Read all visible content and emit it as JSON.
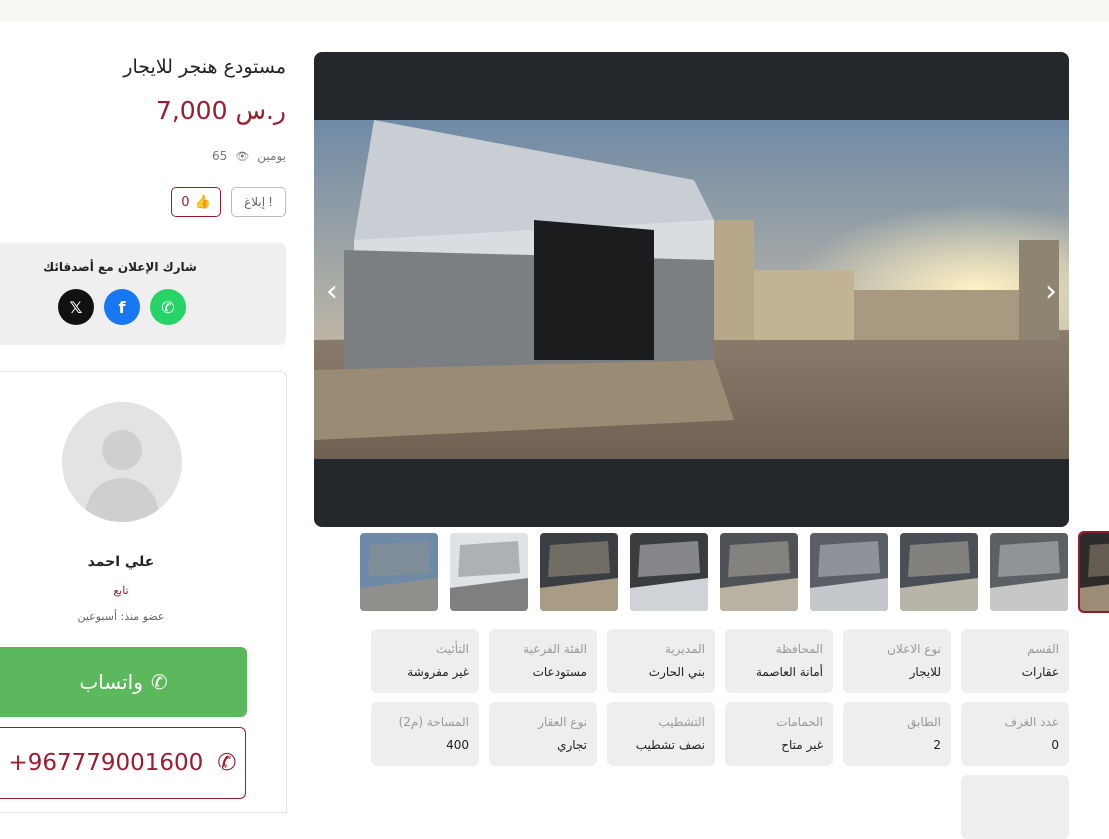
{
  "listing": {
    "title": "مستودع هنجر للايجار",
    "price": "7,000 ر.س",
    "posted": "يومين",
    "views": "65",
    "report_label": "إبلاغ",
    "likes": "0"
  },
  "share": {
    "title": "شارك الإعلان مع أصدقائك",
    "networks": [
      {
        "name": "x",
        "color": "#111111"
      },
      {
        "name": "facebook",
        "color": "#1877f2"
      },
      {
        "name": "whatsapp",
        "color": "#25d366"
      }
    ]
  },
  "seller": {
    "name": "علي احمد",
    "type": "تابع",
    "member_since": "عضو منذ: أسبوعين",
    "whatsapp_label": "واتساب",
    "phone": "+967779001600"
  },
  "gallery": {
    "thumbnail_count": 9,
    "active_index": 0
  },
  "details": [
    {
      "label": "القسم",
      "value": "عقارات"
    },
    {
      "label": "نوع الاعلان",
      "value": "للايجار"
    },
    {
      "label": "المحافظة",
      "value": "أمانة العاصمة"
    },
    {
      "label": "المديرية",
      "value": "بني الحارث"
    },
    {
      "label": "الفئة الفرعية",
      "value": "مستودعات"
    },
    {
      "label": "التأثيث",
      "value": "غير مفروشة"
    },
    {
      "label": "عدد الغرف",
      "value": "0"
    },
    {
      "label": "الطابق",
      "value": "2"
    },
    {
      "label": "الحمامات",
      "value": "غير متاح"
    },
    {
      "label": "التشطيب",
      "value": "نصف تشطيب"
    },
    {
      "label": "نوع العقار",
      "value": "تجاري"
    },
    {
      "label": "المساحة (م2)",
      "value": "400"
    }
  ],
  "colors": {
    "accent": "#9b1c2e",
    "whatsapp": "#5cb85c"
  }
}
